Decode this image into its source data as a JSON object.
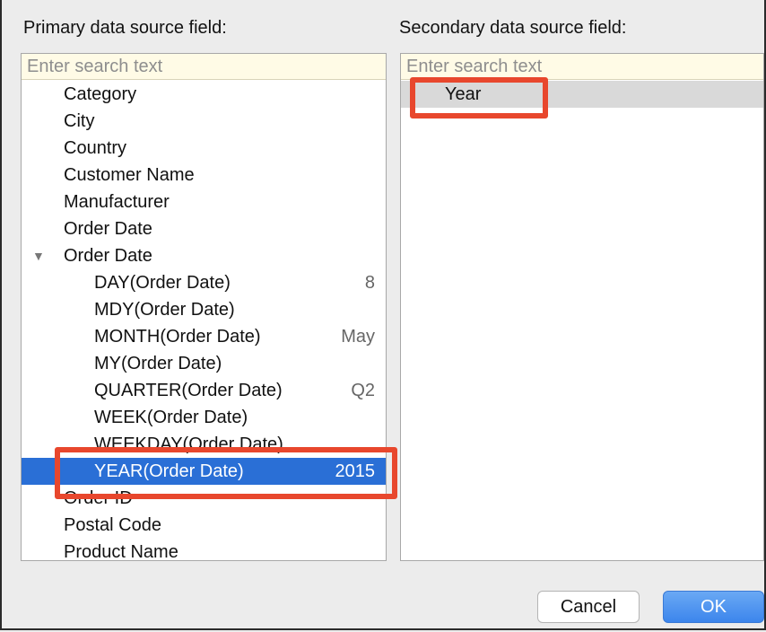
{
  "primary": {
    "label": "Primary data source field:",
    "search_placeholder": "Enter search text",
    "items": [
      {
        "label": "Category",
        "value": "",
        "expanded": false
      },
      {
        "label": "City",
        "value": "",
        "expanded": false
      },
      {
        "label": "Country",
        "value": "",
        "expanded": false
      },
      {
        "label": "Customer Name",
        "value": "",
        "expanded": false
      },
      {
        "label": "Manufacturer",
        "value": "",
        "expanded": false
      },
      {
        "label": "Order Date",
        "value": "",
        "expanded": false
      },
      {
        "label": "Order Date",
        "value": "",
        "expanded": true
      },
      {
        "label": "DAY(Order Date)",
        "value": "8"
      },
      {
        "label": "MDY(Order Date)",
        "value": ""
      },
      {
        "label": "MONTH(Order Date)",
        "value": "May"
      },
      {
        "label": "MY(Order Date)",
        "value": ""
      },
      {
        "label": "QUARTER(Order Date)",
        "value": "Q2"
      },
      {
        "label": "WEEK(Order Date)",
        "value": ""
      },
      {
        "label": "WEEKDAY(Order Date)",
        "value": ""
      },
      {
        "label": "YEAR(Order Date)",
        "value": "2015",
        "selected": true
      },
      {
        "label": "Order ID",
        "value": ""
      },
      {
        "label": "Postal Code",
        "value": ""
      },
      {
        "label": "Product Name",
        "value": ""
      }
    ]
  },
  "secondary": {
    "label": "Secondary data source field:",
    "search_placeholder": "Enter search text",
    "items": [
      {
        "label": "Year",
        "selected": true
      }
    ]
  },
  "buttons": {
    "cancel": "Cancel",
    "ok": "OK"
  },
  "colors": {
    "selection": "#2a6fd6",
    "highlight": "#e8472d",
    "search_bg": "#fffbe6"
  }
}
